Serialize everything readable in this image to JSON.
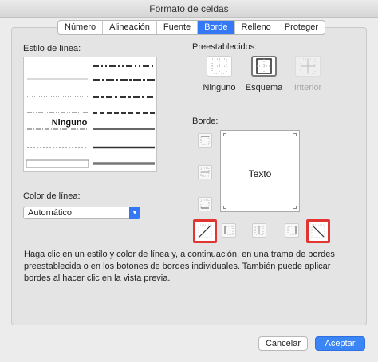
{
  "window": {
    "title": "Formato de celdas"
  },
  "tabs": [
    {
      "label": "Número"
    },
    {
      "label": "Alineación"
    },
    {
      "label": "Fuente"
    },
    {
      "label": "Borde",
      "active": true
    },
    {
      "label": "Relleno"
    },
    {
      "label": "Proteger"
    }
  ],
  "line_style": {
    "label": "Estilo de línea:",
    "none_label": "Ninguno"
  },
  "line_color": {
    "label": "Color de línea:",
    "value": "Automático"
  },
  "presets": {
    "label": "Preestablecidos:",
    "items": [
      {
        "label": "Ninguno"
      },
      {
        "label": "Esquema"
      },
      {
        "label": "Interior"
      }
    ]
  },
  "border": {
    "label": "Borde:",
    "preview_text": "Texto"
  },
  "help_text": "Haga clic en un estilo y color de línea y, a continuación, en una trama de bordes preestablecida o en los botones de bordes individuales. También puede aplicar bordes al hacer clic en la vista previa.",
  "buttons": {
    "cancel": "Cancelar",
    "ok": "Aceptar"
  },
  "colors": {
    "accent": "#3478f6",
    "highlight": "#e03530"
  }
}
